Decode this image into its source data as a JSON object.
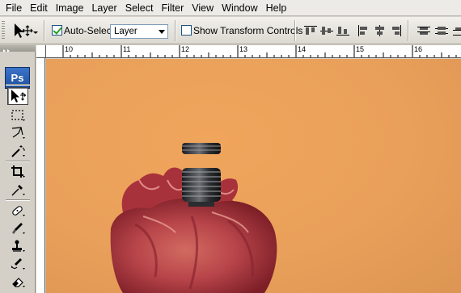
{
  "menubar": {
    "items": [
      "File",
      "Edit",
      "Image",
      "Layer",
      "Select",
      "Filter",
      "View",
      "Window",
      "Help"
    ]
  },
  "options": {
    "tool_icon": "move-tool-icon",
    "auto_select_label": "Auto-Select:",
    "auto_select_checked": true,
    "auto_select_value": "Layer",
    "show_transform_label": "Show Transform Controls",
    "show_transform_checked": false,
    "align_buttons": [
      "align-top-edges-icon",
      "align-vertical-centers-icon",
      "align-bottom-edges-icon",
      "align-left-edges-icon",
      "align-horizontal-centers-icon",
      "align-right-edges-icon",
      "distribute-top-icon",
      "distribute-vertical-centers-icon"
    ]
  },
  "toolbox": {
    "logo": "Ps",
    "tools": [
      "move-tool-icon",
      "marquee-tool-icon",
      "lasso-tool-icon",
      "magic-wand-tool-icon",
      "crop-tool-icon",
      "eyedropper-tool-icon",
      "healing-brush-tool-icon",
      "brush-tool-icon",
      "clone-stamp-tool-icon",
      "history-brush-tool-icon",
      "eraser-tool-icon"
    ],
    "active_tool": "move-tool-icon"
  },
  "ruler": {
    "labels": [
      "10",
      "11",
      "12",
      "13",
      "14",
      "15",
      "16"
    ]
  },
  "canvas": {
    "background_color": "#e9a05a",
    "subject": "anatomical-heart-with-bellows-connector-image"
  }
}
